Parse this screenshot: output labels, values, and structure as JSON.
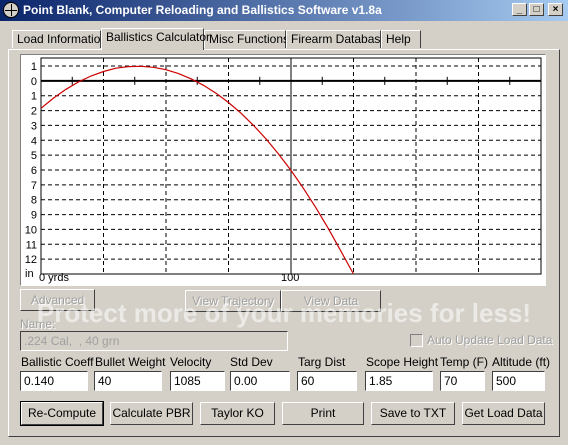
{
  "window": {
    "title": "Point Blank, Computer Reloading and Ballistics Software v1.8a",
    "buttons": [
      "_",
      "□",
      "×"
    ]
  },
  "tabs": [
    {
      "label": "Load Information",
      "active": false
    },
    {
      "label": "Ballistics Calculator",
      "active": true
    },
    {
      "label": "Misc Functions",
      "active": false
    },
    {
      "label": "Firearm Database",
      "active": false
    },
    {
      "label": "Help",
      "active": false
    }
  ],
  "chart_data": {
    "type": "line",
    "title": "",
    "xlabel": "",
    "ylabel": "in",
    "xlim": [
      0,
      200
    ],
    "ylim": [
      -13,
      1
    ],
    "y_axis_inverted": true,
    "grid": true,
    "yticks": [
      1,
      0,
      1,
      2,
      3,
      4,
      5,
      6,
      7,
      8,
      9,
      10,
      11,
      12
    ],
    "xtick_labels": [
      {
        "x": 0,
        "label": "0 yrds"
      },
      {
        "x": 100,
        "label": "100"
      }
    ],
    "series": [
      {
        "color": "#cc0000",
        "x": [
          0,
          5,
          10,
          15,
          20,
          25,
          30,
          35,
          40,
          45,
          50,
          55,
          60,
          65,
          70,
          75,
          80,
          85,
          90,
          95,
          100,
          105,
          110,
          115,
          120,
          125
        ],
        "y": [
          -1.85,
          -1.16,
          -0.57,
          -0.07,
          0.33,
          0.63,
          0.85,
          0.96,
          0.98,
          0.91,
          0.75,
          0.49,
          0.14,
          -0.3,
          -0.83,
          -1.46,
          -2.18,
          -3.0,
          -3.91,
          -4.92,
          -6.03,
          -7.24,
          -8.55,
          -9.96,
          -11.47,
          -13.0
        ]
      }
    ]
  },
  "buttons_row1": {
    "advanced": "Advanced",
    "view_trajectory": "View Trajectory",
    "view_data": "View Data"
  },
  "name": {
    "label": "Name:",
    "value": ".224 Cal,  , 40 grn"
  },
  "auto_update": {
    "label": "Auto Update Load Data",
    "checked": false
  },
  "fields": [
    {
      "label": "Ballistic Coeff",
      "value": "0.140"
    },
    {
      "label": "Bullet Weight",
      "value": "40"
    },
    {
      "label": "Velocity",
      "value": "1085"
    },
    {
      "label": "Std Dev",
      "value": "0.00"
    },
    {
      "label": "Targ Dist",
      "value": "60"
    },
    {
      "label": "Scope Height",
      "value": "1.85"
    },
    {
      "label": "Temp (F)",
      "value": "70"
    },
    {
      "label": "Altitude (ft)",
      "value": "500"
    }
  ],
  "bottom_buttons": {
    "recompute": "Re-Compute",
    "calc_pbr": "Calculate PBR",
    "taylor_ko": "Taylor KO",
    "print": "Print",
    "save_txt": "Save to TXT",
    "get_load": "Get Load Data"
  },
  "watermark": {
    "line1": "Protect more of your memories for less!"
  }
}
